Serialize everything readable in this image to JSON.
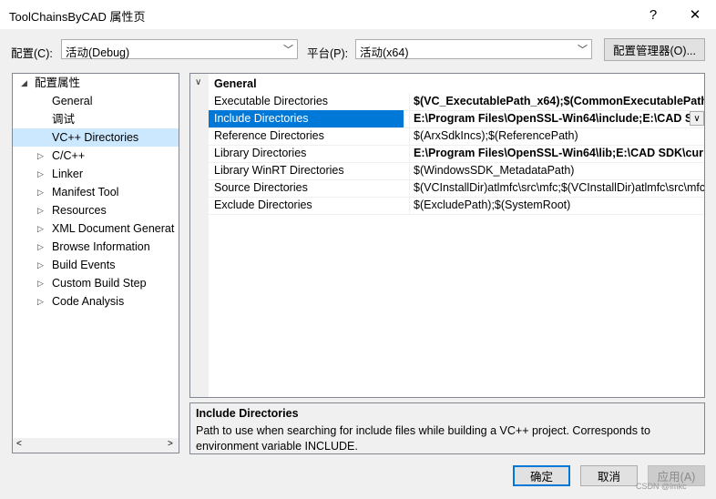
{
  "window": {
    "title": "ToolChainsByCAD 属性页",
    "help": "?",
    "close": "✕"
  },
  "config": {
    "label": "配置(C):",
    "value": "活动(Debug)"
  },
  "platform": {
    "label": "平台(P):",
    "value": "活动(x64)"
  },
  "config_manager_label": "配置管理器(O)...",
  "tree": {
    "root": "配置属性",
    "items": [
      {
        "label": "General",
        "expandable": false
      },
      {
        "label": "调试",
        "expandable": false
      },
      {
        "label": "VC++ Directories",
        "expandable": false,
        "selected": true
      },
      {
        "label": "C/C++",
        "expandable": true
      },
      {
        "label": "Linker",
        "expandable": true
      },
      {
        "label": "Manifest Tool",
        "expandable": true
      },
      {
        "label": "Resources",
        "expandable": true
      },
      {
        "label": "XML Document Generat",
        "expandable": true
      },
      {
        "label": "Browse Information",
        "expandable": true
      },
      {
        "label": "Build Events",
        "expandable": true
      },
      {
        "label": "Custom Build Step",
        "expandable": true
      },
      {
        "label": "Code Analysis",
        "expandable": true
      }
    ]
  },
  "grid": {
    "section": "General",
    "rows": [
      {
        "name": "Executable Directories",
        "value": "$(VC_ExecutablePath_x64);$(CommonExecutablePath)",
        "bold": true
      },
      {
        "name": "Include Directories",
        "value": "E:\\Program Files\\OpenSSL-Win64\\include;E:\\CAD S",
        "bold": true,
        "selected": true
      },
      {
        "name": "Reference Directories",
        "value": "$(ArxSdkIncs);$(ReferencePath)",
        "bold": false
      },
      {
        "name": "Library Directories",
        "value": "E:\\Program Files\\OpenSSL-Win64\\lib;E:\\CAD SDK\\cur",
        "bold": true
      },
      {
        "name": "Library WinRT Directories",
        "value": "$(WindowsSDK_MetadataPath)",
        "bold": false
      },
      {
        "name": "Source Directories",
        "value": "$(VCInstallDir)atlmfc\\src\\mfc;$(VCInstallDir)atlmfc\\src\\mfc",
        "bold": false
      },
      {
        "name": "Exclude Directories",
        "value": "$(ExcludePath);$(SystemRoot)",
        "bold": false
      }
    ]
  },
  "description": {
    "title": "Include Directories",
    "text": "Path to use when searching for include files while building a VC++ project.  Corresponds to environment variable INCLUDE."
  },
  "buttons": {
    "ok": "确定",
    "cancel": "取消",
    "apply": "应用(A)"
  },
  "watermark": "CSDN @lmkc",
  "colors": {
    "selection": "#0078d7",
    "tree_selection": "#cce8ff"
  }
}
